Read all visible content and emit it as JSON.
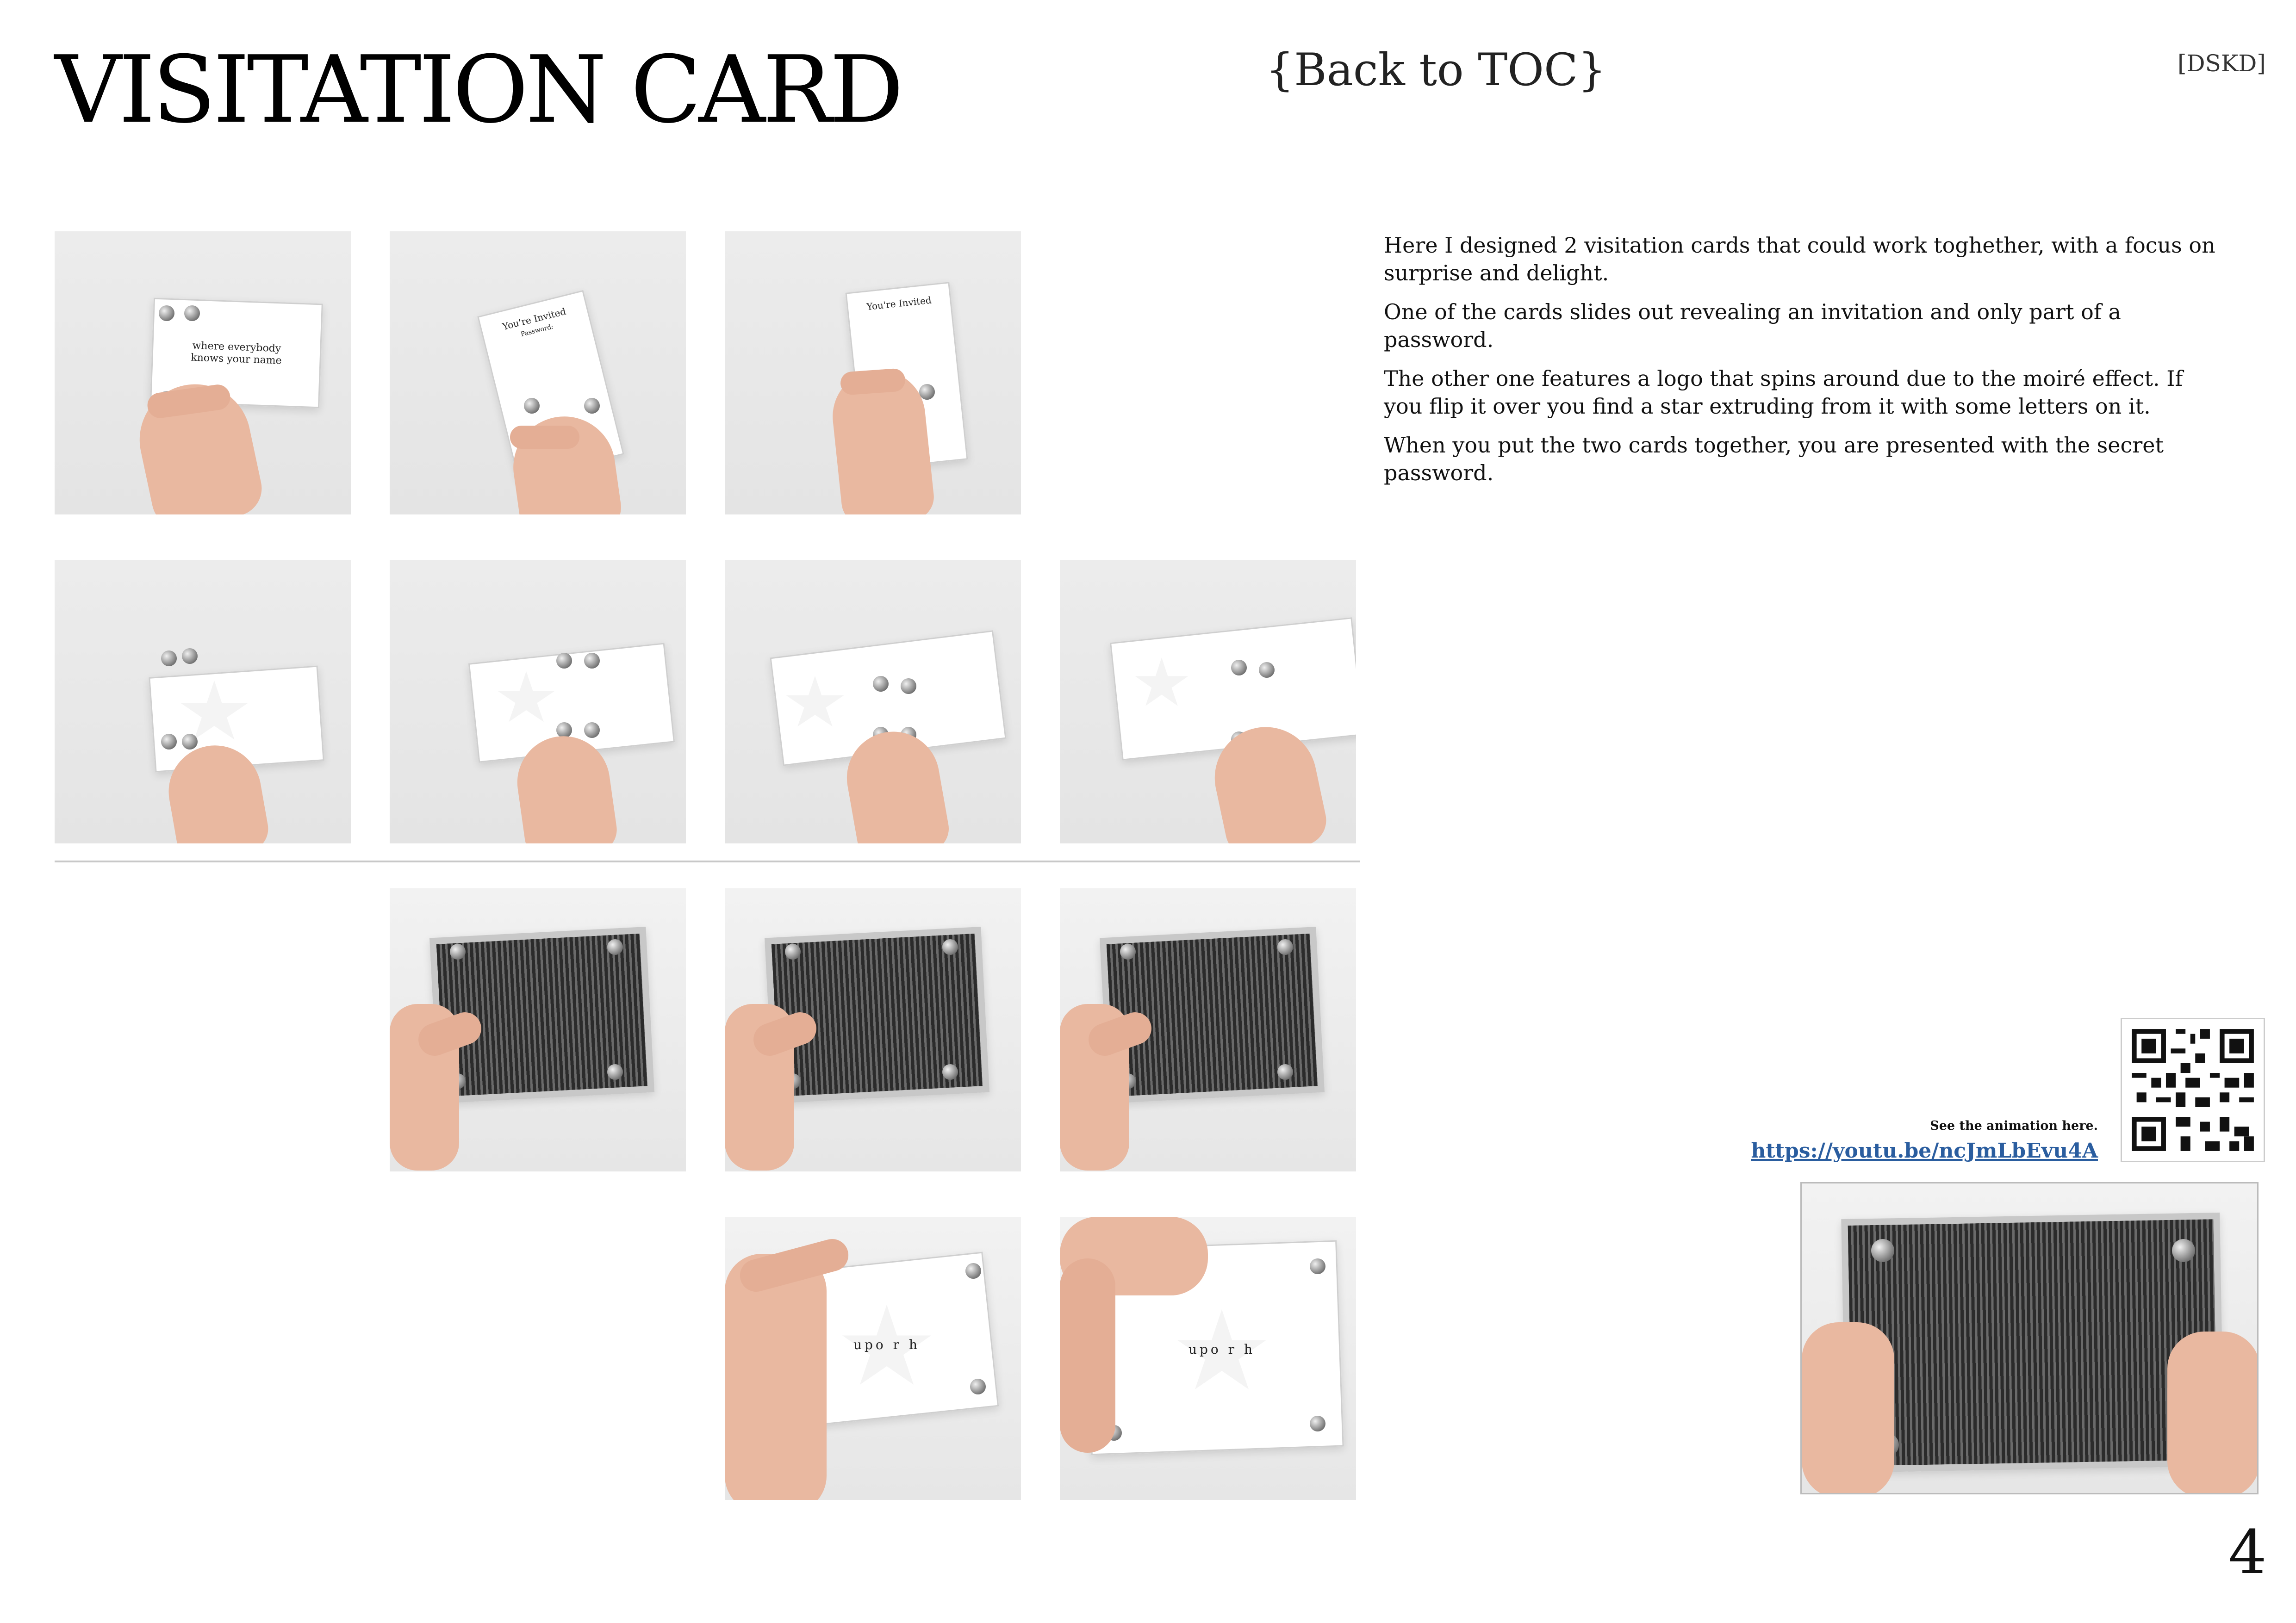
{
  "header": {
    "title": "VISITATION CARD",
    "toc_link": "{Back to TOC}",
    "tag": "[DSKD]"
  },
  "description": {
    "p1": "Here I designed 2 visitation cards that could work toghether, with a focus on surprise and delight.",
    "p2": "One of the cards slides out revealing an invitation and only part of a password.",
    "p3": "The other one features a logo that spins around due to the moiré effect. If you flip it over you find a star extruding from it with some letters on it.",
    "p4": "When you put the two cards together, you are presented with the secret password."
  },
  "card_text": {
    "front": "where everybody knows your name",
    "invite": "You're Invited",
    "password": "Password:",
    "star_letters": "upo r h"
  },
  "animation": {
    "caption": "See the animation here.",
    "url": "https://youtu.be/ncJmLbEvu4A"
  },
  "page_number": "4"
}
